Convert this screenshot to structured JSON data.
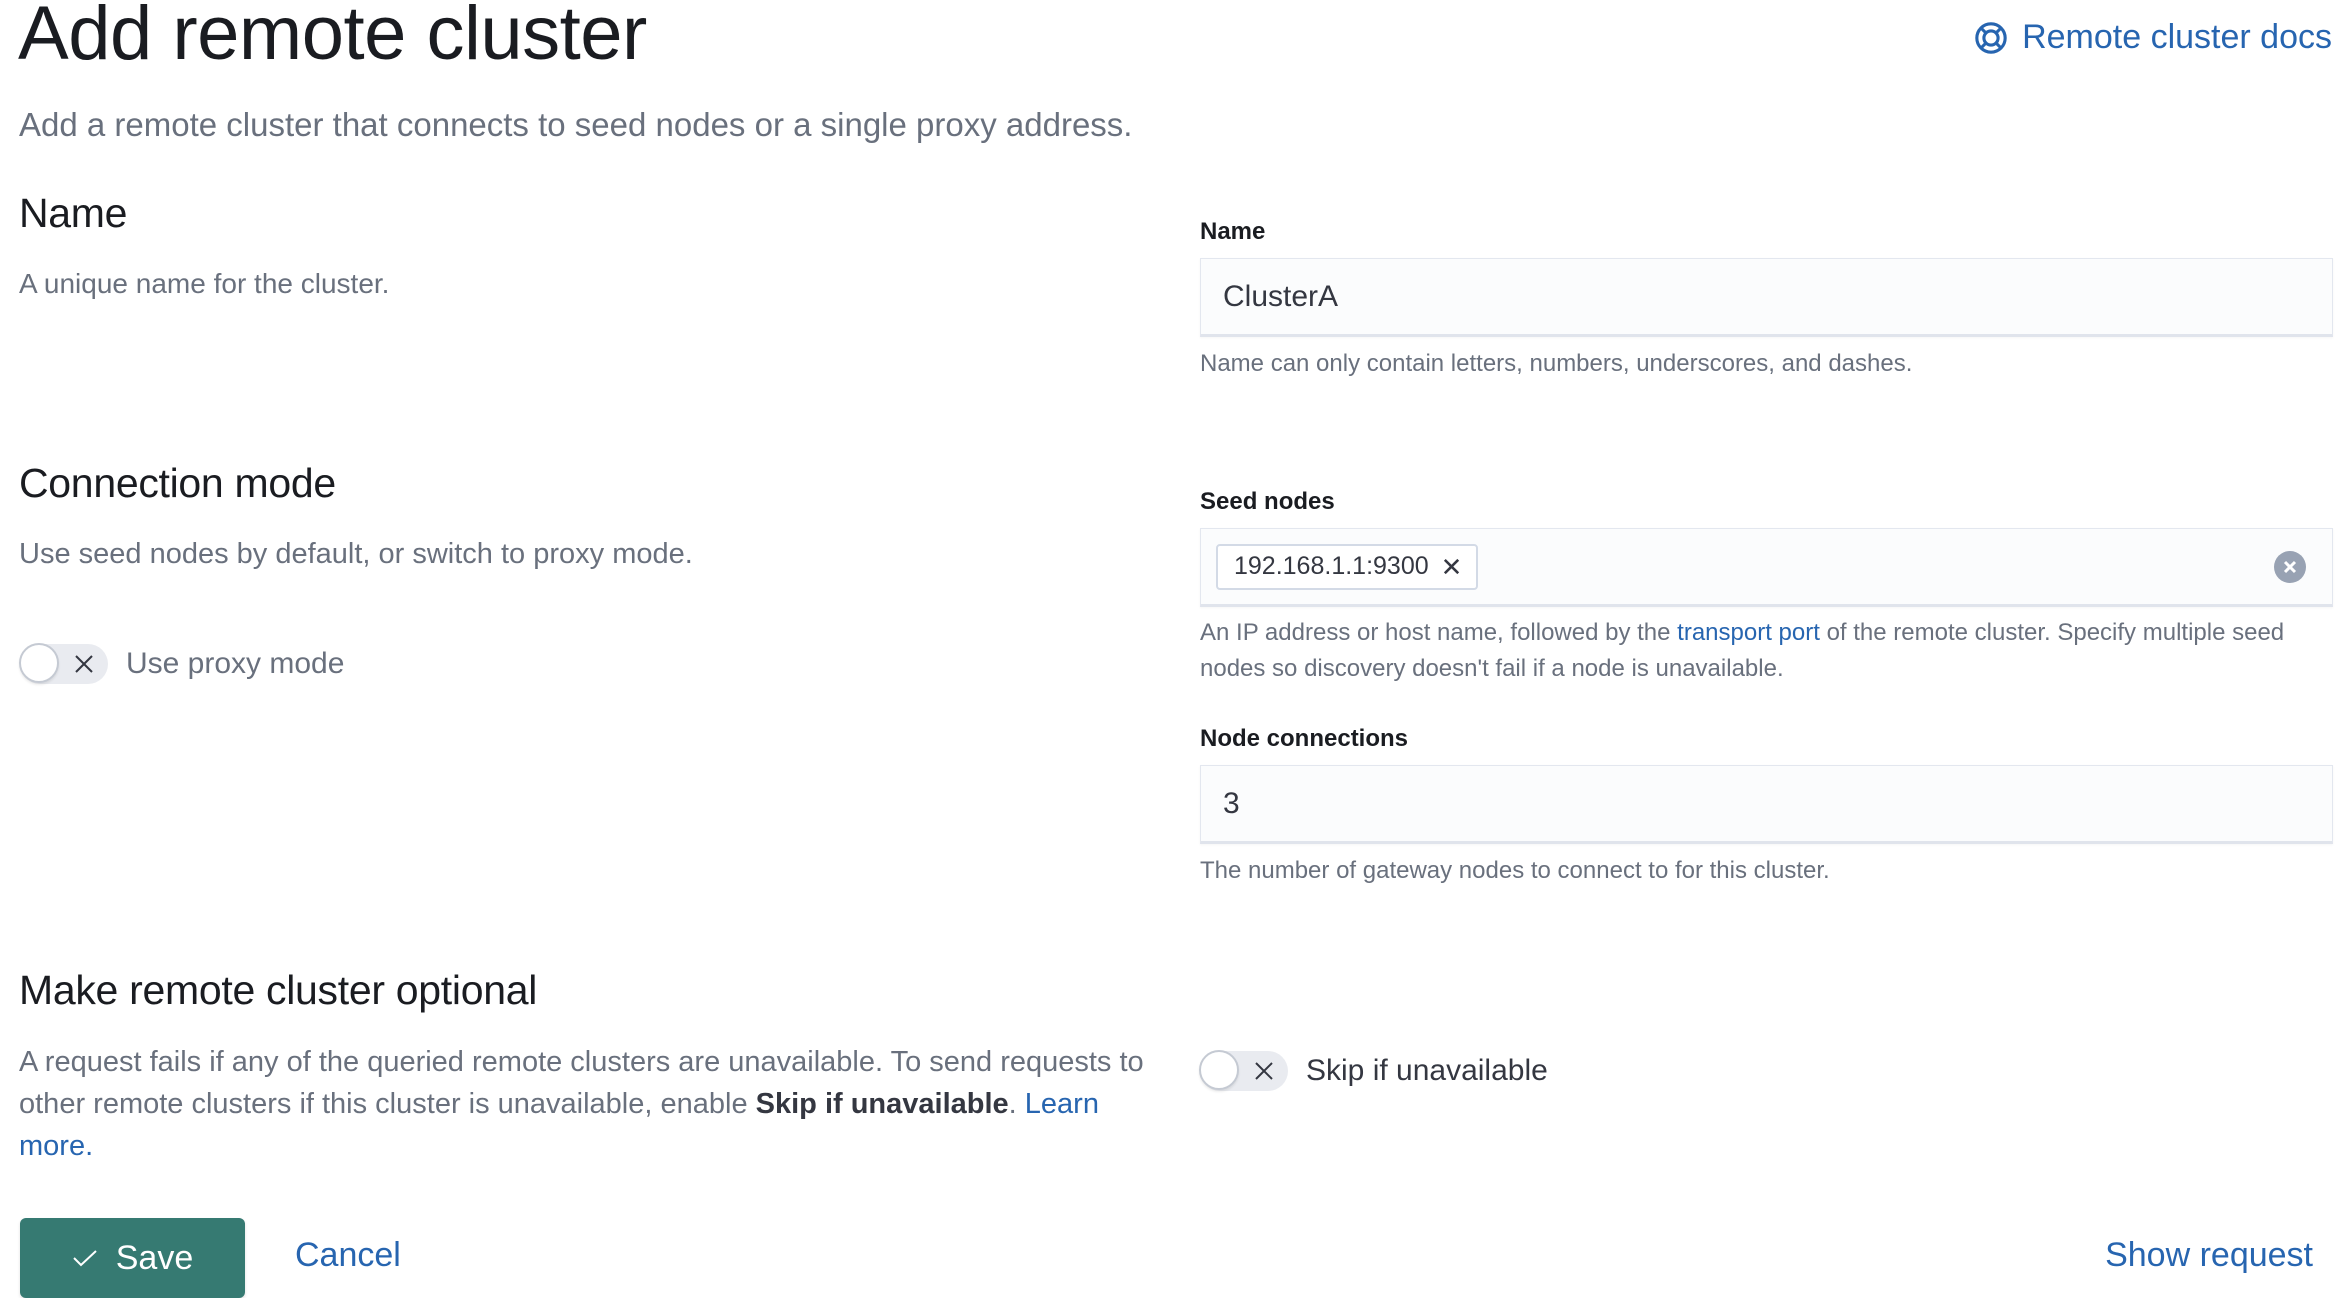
{
  "header": {
    "title": "Add remote cluster",
    "subtitle": "Add a remote cluster that connects to seed nodes or a single proxy address.",
    "docs_link": {
      "label": "Remote cluster docs",
      "icon": "help-lifebuoy-icon"
    }
  },
  "sections": {
    "name": {
      "title": "Name",
      "description": "A unique name for the cluster."
    },
    "connection_mode": {
      "title": "Connection mode",
      "description": "Use seed nodes by default, or switch to proxy mode.",
      "proxy_toggle": {
        "label": "Use proxy mode",
        "checked": false
      }
    },
    "optional": {
      "title": "Make remote cluster optional",
      "description_part1": "A request fails if any of the queried remote clusters are unavailable. To send requests to other remote clusters if this cluster is unavailable, enable ",
      "description_bold": "Skip if unavailable",
      "description_part2": ". ",
      "learn_more": "Learn more.",
      "skip_toggle": {
        "label": "Skip if unavailable",
        "checked": false
      }
    }
  },
  "fields": {
    "name": {
      "label": "Name",
      "value": "ClusterA",
      "help": "Name can only contain letters, numbers, underscores, and dashes."
    },
    "seed_nodes": {
      "label": "Seed nodes",
      "values": [
        "192.168.1.1:9300"
      ],
      "help_part1": "An IP address or host name, followed by the ",
      "help_link": "transport port",
      "help_part2": " of the remote cluster. Specify multiple seed nodes so discovery doesn't fail if a node is unavailable."
    },
    "node_connections": {
      "label": "Node connections",
      "value": "3",
      "help": "The number of gateway nodes to connect to for this cluster."
    }
  },
  "footer": {
    "save_label": "Save",
    "cancel_label": "Cancel",
    "show_request_label": "Show request"
  },
  "colors": {
    "primary": "#367a72",
    "link": "#2765b0",
    "text": "#1a1c21",
    "subdued": "#69707d"
  }
}
